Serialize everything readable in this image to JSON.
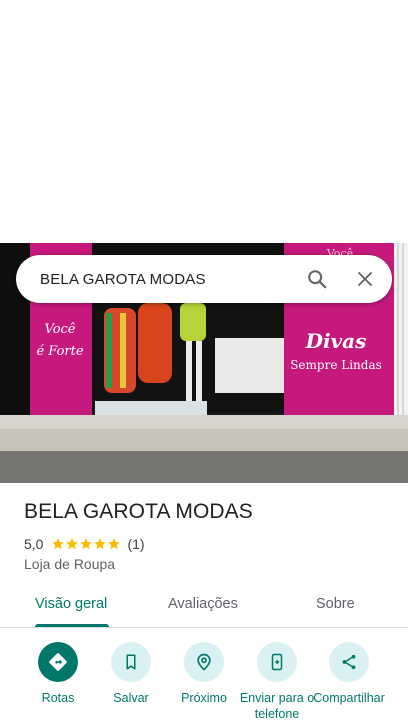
{
  "search": {
    "query": "BELA GAROTA MODAS"
  },
  "photo": {
    "sign_left_line1": "Você",
    "sign_left_line2": "é Forte",
    "sign_right_line1": "Divas",
    "sign_right_line2": "Sempre Lindas",
    "sign_right_top": "Você"
  },
  "place": {
    "title": "BELA GAROTA MODAS",
    "rating": "5,0",
    "review_count": "(1)",
    "stars": 5,
    "category": "Loja de Roupa"
  },
  "tabs": [
    {
      "label": "Visão geral",
      "active": true
    },
    {
      "label": "Avaliações",
      "active": false
    },
    {
      "label": "Sobre",
      "active": false
    }
  ],
  "actions": [
    {
      "label": "Rotas",
      "icon": "directions-icon"
    },
    {
      "label": "Salvar",
      "icon": "bookmark-icon"
    },
    {
      "label": "Próximo",
      "icon": "nearby-icon"
    },
    {
      "label": "Enviar para o telefone",
      "icon": "send-to-phone-icon"
    },
    {
      "label": "Compartilhar",
      "icon": "share-icon"
    }
  ],
  "colors": {
    "accent": "#00796b",
    "action_bg": "#d9f1f2",
    "star": "#fbbc04",
    "sign_pink": "#c5197d"
  }
}
